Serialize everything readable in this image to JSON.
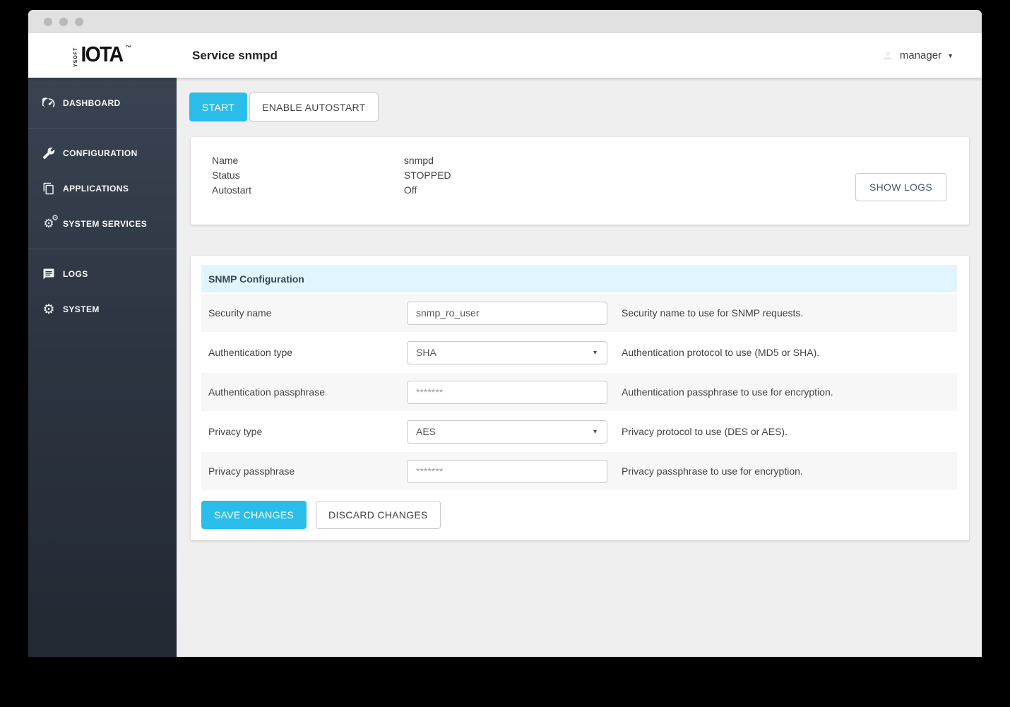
{
  "header": {
    "logo": {
      "prefix": "YSOFT",
      "brand": "IOTA",
      "tm": "™"
    },
    "title": "Service snmpd",
    "user": {
      "name": "manager",
      "icon": "person-icon",
      "caret": "▼"
    }
  },
  "sidebar": {
    "items": [
      {
        "label": "DASHBOARD",
        "icon": "dashboard-icon"
      },
      {
        "label": "CONFIGURATION",
        "icon": "wrench-icon"
      },
      {
        "label": "APPLICATIONS",
        "icon": "applications-icon"
      },
      {
        "label": "SYSTEM SERVICES",
        "icon": "gears-icon"
      },
      {
        "label": "LOGS",
        "icon": "logs-icon"
      },
      {
        "label": "SYSTEM",
        "icon": "gear-icon"
      }
    ]
  },
  "service": {
    "actions": {
      "start": "START",
      "enable_autostart": "ENABLE AUTOSTART"
    },
    "info": {
      "rows": [
        {
          "label": "Name",
          "value": "snmpd"
        },
        {
          "label": "Status",
          "value": "STOPPED"
        },
        {
          "label": "Autostart",
          "value": "Off"
        }
      ],
      "show_logs": "SHOW LOGS"
    }
  },
  "snmp": {
    "title": "SNMP Configuration",
    "rows": [
      {
        "label": "Security name",
        "value": "snmp_ro_user",
        "description": "Security name to use for SNMP requests."
      },
      {
        "label": "Authentication type",
        "value": "SHA",
        "description": "Authentication protocol to use (MD5 or SHA)."
      },
      {
        "label": "Authentication passphrase",
        "placeholder": "*******",
        "description": "Authentication passphrase to use for encryption."
      },
      {
        "label": "Privacy type",
        "value": "AES",
        "description": "Privacy protocol to use (DES or AES)."
      },
      {
        "label": "Privacy passphrase",
        "placeholder": "*******",
        "description": "Privacy passphrase to use for encryption."
      }
    ],
    "save": "SAVE CHANGES",
    "discard": "DISCARD CHANGES"
  },
  "colors": {
    "accent": "#2bbde9",
    "sidebar_top": "#3a4351",
    "sidebar_bottom": "#222933",
    "config_header_bg": "#e0f5fd",
    "row_alt_bg": "#f7f7f7",
    "titlebar_bg": "#e1e1e1"
  },
  "select_caret": "▼"
}
